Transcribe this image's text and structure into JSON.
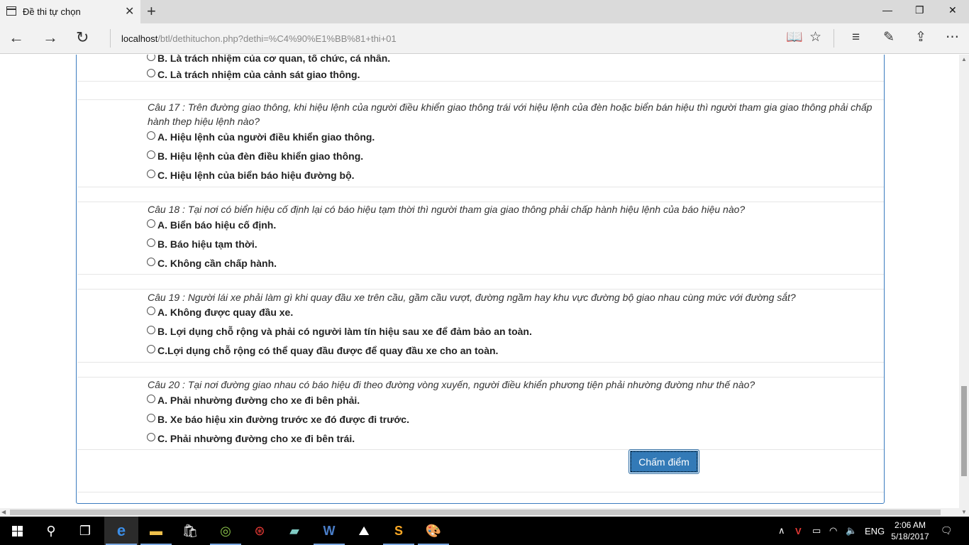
{
  "browser": {
    "tab_title": "Đề thi tự chọn",
    "url_host": "localhost",
    "url_path": "/btl/dethituchon.php?dethi=%C4%90%E1%BB%81+thi+01"
  },
  "page": {
    "partial_top_option": "B. Là trách nhiệm của cơ quan, tổ chức, cá nhân.",
    "partial_top_option_c": "C. Là trách nhiệm của cảnh sát giao thông.",
    "questions": [
      {
        "text": "Câu 17 : Trên đường giao thông, khi hiệu lệnh của người điều khiển giao thông trái với hiệu lệnh của đèn hoặc biển bán hiệu thì người tham gia giao thông phải chấp hành thep hiệu lệnh nào?",
        "options": [
          "A. Hiệu lệnh của người điều khiển giao thông.",
          "B. Hiệu lệnh của đèn điều khiển giao thông.",
          "C. Hiệu lệnh của biển báo hiệu đường bộ."
        ]
      },
      {
        "text": "Câu 18 : Tại nơi có biển hiệu cố định lại có báo hiệu tạm thời thì người tham gia giao thông phải chấp hành hiệu lệnh của báo hiệu nào?",
        "options": [
          "A. Biển báo hiệu cố định.",
          "B. Báo hiệu tạm thời.",
          "C. Không cần chấp hành."
        ]
      },
      {
        "text": "Câu 19 : Người lái xe phải làm gì khi quay đầu xe trên cầu, gầm cầu vượt, đường ngầm hay khu vực đường bộ giao nhau cùng mức với đường sắt?",
        "options": [
          "A. Không được quay đầu xe.",
          "B. Lợi dụng chỗ rộng và phải có người làm tín hiệu sau xe để đảm bảo an toàn.",
          "C.Lợi dụng chỗ rộng có thể quay đầu được để quay đầu xe cho an toàn."
        ]
      },
      {
        "text": "Câu 20 : Tại nơi đường giao nhau có báo hiệu đi theo đường vòng xuyến, người điều khiển phương tiện phải nhường đường như thế nào?",
        "options": [
          "A. Phải nhường đường cho xe đi bên phải.",
          "B. Xe báo hiệu xin đường trước xe đó được đi trước.",
          "C. Phải nhường đường cho xe đi bên trái."
        ]
      }
    ],
    "submit_label": "Chấm điểm"
  },
  "taskbar": {
    "language": "ENG",
    "time": "2:06 AM",
    "date": "5/18/2017"
  },
  "icons": [
    "page-icon",
    "close-icon",
    "plus-icon",
    "minimize-icon",
    "restore-icon",
    "back-icon",
    "forward-icon",
    "refresh-icon",
    "reading-view-icon",
    "favorite-star-icon",
    "hub-icon",
    "web-note-icon",
    "share-icon",
    "more-icon",
    "windows-start-icon",
    "search-icon",
    "task-view-icon",
    "edge-icon",
    "file-explorer-icon",
    "store-icon",
    "app-icon",
    "word-icon",
    "photos-icon",
    "sublime-icon",
    "paint-icon",
    "chevron-up-icon",
    "network-icon",
    "volume-icon",
    "notification-icon"
  ],
  "colors": {
    "accent": "#337ab7",
    "container_border": "#3a7bbf"
  }
}
